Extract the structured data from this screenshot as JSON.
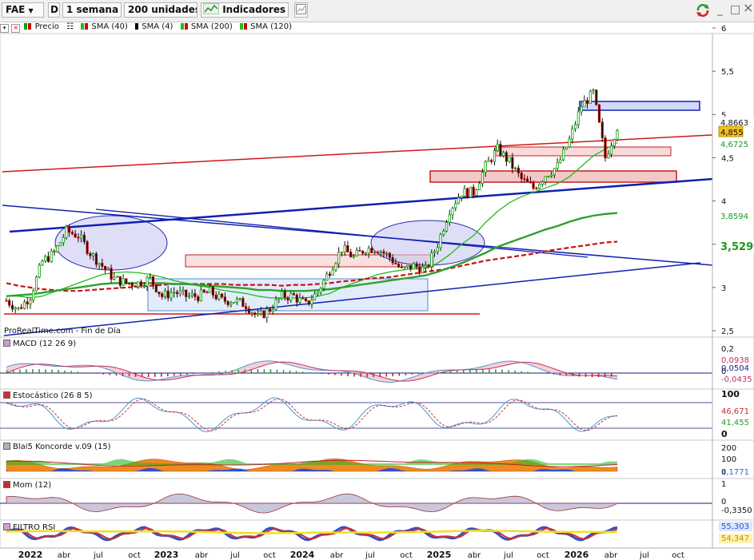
{
  "toolbar": {
    "symbol": "FAE",
    "period_code": "D",
    "timeframe": "1 semana",
    "units": "200 unidades",
    "indicators_label": "Indicadores",
    "window_min": "_",
    "window_max": "□",
    "window_close": "×"
  },
  "legend": {
    "price": "Precio",
    "sma1": "SMA (40)",
    "sma2": "SMA (4)",
    "sma3": "SMA (200)",
    "sma4": "SMA (120)"
  },
  "watermark": "ProRealTime.com - Fin de Día",
  "colors": {
    "up": "#00a000",
    "down": "#d00000",
    "sma40": "#1cbd1c",
    "sma200": "#c81414",
    "sma120": "#2ea02e",
    "trend_blue": "#1020b0",
    "trend_red": "#d01818"
  },
  "price_panel": {
    "y_ticks": [
      "6",
      "5,5",
      "5",
      "4,5",
      "4",
      "3,5",
      "3",
      "2,5"
    ],
    "tags": [
      {
        "text": "4,8663",
        "bg": "#ffffff",
        "fg": "#111111"
      },
      {
        "text": "4,855",
        "bg": "#f0c020",
        "fg": "#111111"
      },
      {
        "text": "4,6725",
        "bg": "#ffffff",
        "fg": "#1a9a1a"
      },
      {
        "text": "3,8594",
        "bg": "#ffffff",
        "fg": "#1a9a1a"
      },
      {
        "text": "3,5290",
        "bg": "#ffffff",
        "fg": "#1a9a1a"
      }
    ]
  },
  "panels": {
    "macd": {
      "title": "MACD (12 26 9)",
      "ticks": [
        "0,2",
        "0"
      ],
      "tags": [
        "0,0938",
        "0,0504",
        "-0,0435"
      ]
    },
    "stoch": {
      "title": "Estocástico (26 8 5)",
      "ticks": [
        "100",
        "0"
      ],
      "tags": [
        "46,671",
        "41,455"
      ]
    },
    "koncorde": {
      "title": "Blai5 Koncorde v.09 (15)",
      "ticks": [
        "200",
        "100",
        "0"
      ],
      "tags": [
        "1,1771"
      ]
    },
    "mom": {
      "title": "Mom (12)",
      "ticks": [
        "1",
        "0"
      ],
      "tags": [
        "-0,3350"
      ]
    },
    "rsi": {
      "title": "FILTRO RSI",
      "tags": [
        "55,303",
        "54,347"
      ]
    }
  },
  "x_axis": {
    "labels": [
      "2022",
      "abr",
      "jul",
      "oct",
      "2023",
      "abr",
      "jul",
      "oct",
      "2024",
      "abr",
      "jul",
      "oct",
      "2025",
      "abr",
      "jul",
      "oct",
      "2026",
      "abr",
      "jul",
      "oct"
    ]
  },
  "chart_data": {
    "type": "line",
    "x": [
      "2022-01",
      "2022-02",
      "2022-03",
      "2022-04",
      "2022-05",
      "2022-06",
      "2022-07",
      "2022-08",
      "2022-09",
      "2022-10",
      "2022-11",
      "2022-12",
      "2023-01",
      "2023-02",
      "2023-03",
      "2023-04",
      "2023-05",
      "2023-06",
      "2023-07",
      "2023-08",
      "2023-09",
      "2023-10",
      "2023-11",
      "2023-12",
      "2024-01",
      "2024-02",
      "2024-03",
      "2024-04",
      "2024-05",
      "2024-06",
      "2024-07",
      "2024-08",
      "2024-09",
      "2024-10",
      "2024-11",
      "2024-12",
      "2025-01",
      "2025-02",
      "2025-03",
      "2025-04",
      "2025-05",
      "2025-06",
      "2025-07",
      "2025-08",
      "2025-09",
      "2025-10",
      "2025-11",
      "2025-12",
      "2026-01",
      "2026-02",
      "2026-03",
      "2026-04"
    ],
    "series": [
      {
        "name": "Precio",
        "values": [
          2.85,
          2.75,
          2.9,
          3.3,
          3.4,
          3.65,
          3.6,
          3.4,
          3.25,
          3.1,
          3.05,
          3.05,
          3.1,
          2.9,
          2.95,
          2.9,
          2.9,
          2.95,
          2.85,
          2.85,
          2.8,
          2.65,
          2.75,
          2.9,
          2.9,
          2.8,
          2.95,
          3.2,
          3.45,
          3.35,
          3.45,
          3.45,
          3.35,
          3.2,
          3.25,
          3.2,
          3.5,
          3.9,
          4.1,
          4.1,
          4.4,
          4.6,
          4.45,
          4.25,
          4.15,
          4.3,
          4.4,
          4.7,
          5.1,
          5.25,
          4.5,
          4.86
        ]
      },
      {
        "name": "SMA (40)",
        "values": [
          2.9,
          2.9,
          2.88,
          2.9,
          2.95,
          3.0,
          3.05,
          3.1,
          3.15,
          3.17,
          3.18,
          3.17,
          3.15,
          3.12,
          3.08,
          3.05,
          3.02,
          3.0,
          2.97,
          2.95,
          2.93,
          2.9,
          2.88,
          2.88,
          2.88,
          2.88,
          2.9,
          2.93,
          3.0,
          3.05,
          3.1,
          3.15,
          3.18,
          3.2,
          3.22,
          3.22,
          3.28,
          3.38,
          3.5,
          3.6,
          3.75,
          3.88,
          3.98,
          4.05,
          4.1,
          4.15,
          4.2,
          4.28,
          4.4,
          4.52,
          4.6,
          4.67
        ]
      },
      {
        "name": "SMA (200)",
        "values": [
          3.05,
          3.02,
          3.0,
          2.98,
          2.97,
          2.96,
          2.96,
          2.97,
          2.98,
          2.99,
          3.0,
          3.01,
          3.02,
          3.03,
          3.04,
          3.04,
          3.04,
          3.04,
          3.04,
          3.03,
          3.03,
          3.03,
          3.03,
          3.02,
          3.03,
          3.03,
          3.04,
          3.05,
          3.07,
          3.08,
          3.1,
          3.11,
          3.12,
          3.14,
          3.16,
          3.18,
          3.2,
          3.22,
          3.25,
          3.28,
          3.31,
          3.33,
          3.35,
          3.37,
          3.39,
          3.42,
          3.44,
          3.46,
          3.48,
          3.5,
          3.52,
          3.53
        ]
      },
      {
        "name": "SMA (120)",
        "values": [
          2.9,
          2.91,
          2.92,
          2.94,
          2.96,
          2.98,
          3.0,
          3.02,
          3.04,
          3.05,
          3.05,
          3.05,
          3.05,
          3.05,
          3.04,
          3.04,
          3.03,
          3.02,
          3.01,
          3.0,
          2.99,
          2.97,
          2.97,
          2.96,
          2.96,
          2.96,
          2.97,
          2.98,
          3.0,
          3.02,
          3.04,
          3.06,
          3.08,
          3.1,
          3.12,
          3.14,
          3.18,
          3.23,
          3.28,
          3.34,
          3.4,
          3.47,
          3.52,
          3.57,
          3.62,
          3.67,
          3.71,
          3.76,
          3.8,
          3.83,
          3.85,
          3.86
        ]
      }
    ],
    "ylim": [
      2.45,
      6.05
    ],
    "grid": false,
    "legend_placement": "top-left"
  }
}
